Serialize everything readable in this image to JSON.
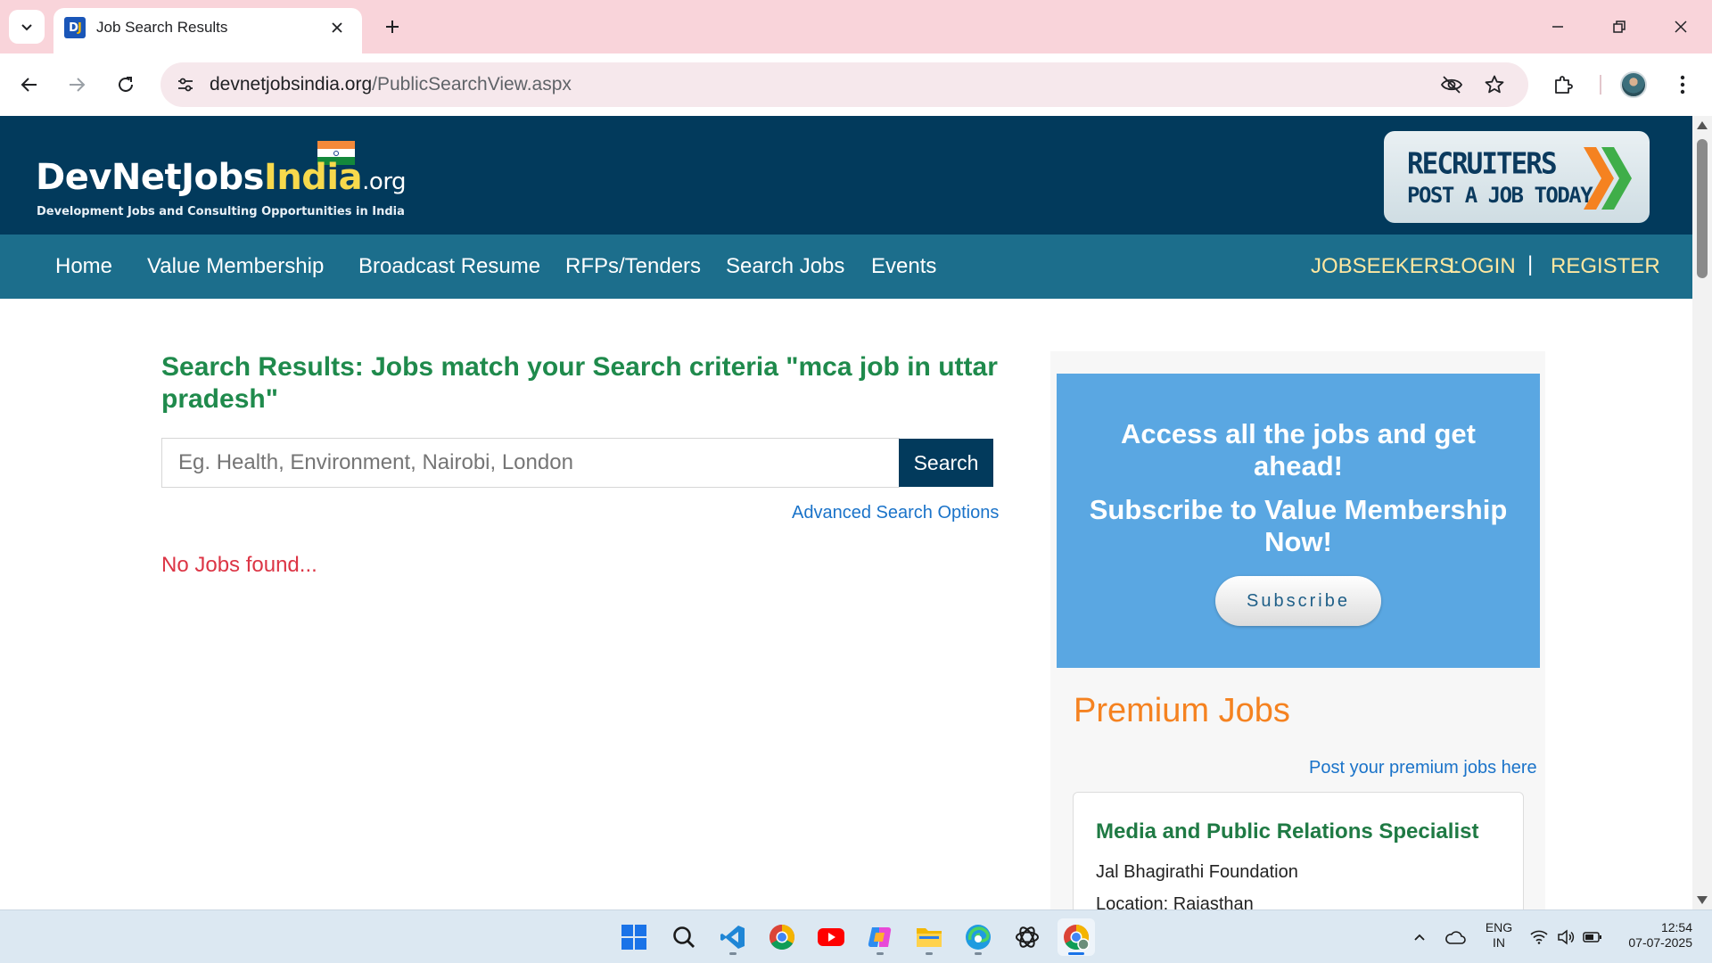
{
  "browser": {
    "tab_title": "Job Search Results",
    "favicon_text": "DJ",
    "url_domain": "devnetjobsindia.org",
    "url_path": "/PublicSearchView.aspx"
  },
  "site": {
    "logo": {
      "devnet": "DevNetJobs",
      "india": "India",
      "org": ".org",
      "tagline": "Development Jobs and Consulting Opportunities in India"
    },
    "recruiter_banner": {
      "line1": "RECRUITERS",
      "line2": "POST A JOB TODAY"
    },
    "nav": {
      "items": [
        "Home",
        "Value Membership",
        "Broadcast Resume",
        "RFPs/Tenders",
        "Search Jobs",
        "Events"
      ],
      "jobseekers_label": "JOBSEEKERS:",
      "login": "LOGIN",
      "separator": "|",
      "register": "REGISTER"
    }
  },
  "main": {
    "heading": "Search Results: Jobs match your Search criteria \"mca job in uttar pradesh\"",
    "search_placeholder": "Eg. Health, Environment, Nairobi, London",
    "search_button": "Search",
    "advanced_link": "Advanced Search Options",
    "no_results": "No Jobs found..."
  },
  "sidebar": {
    "promo_line1": "Access all the jobs and get ahead!",
    "promo_line2": "Subscribe to Value Membership Now!",
    "subscribe_button": "Subscribe",
    "premium_title": "Premium Jobs",
    "premium_link": "Post your premium jobs here",
    "job": {
      "title": "Media and Public Relations Specialist",
      "org": "Jal Bhagirathi Foundation",
      "location": "Location: Rajasthan"
    }
  },
  "taskbar": {
    "apps": [
      "start-icon",
      "search-icon",
      "vscode-icon",
      "chrome-icon",
      "youtube-icon",
      "copilot-icon",
      "file-explorer-icon",
      "edge-icon",
      "chatgpt-icon",
      "chrome-profile-icon"
    ],
    "lang_top": "ENG",
    "lang_bottom": "IN",
    "time": "12:54",
    "date": "07-07-2025"
  },
  "colors": {
    "header_bg": "#023a5c",
    "nav_bg": "#1c6e8c",
    "heading_green": "#1f8a4c",
    "error_red": "#dc3545",
    "promo_blue": "#5aa7e2",
    "premium_orange": "#f58220",
    "link_blue": "#1a73c9"
  }
}
